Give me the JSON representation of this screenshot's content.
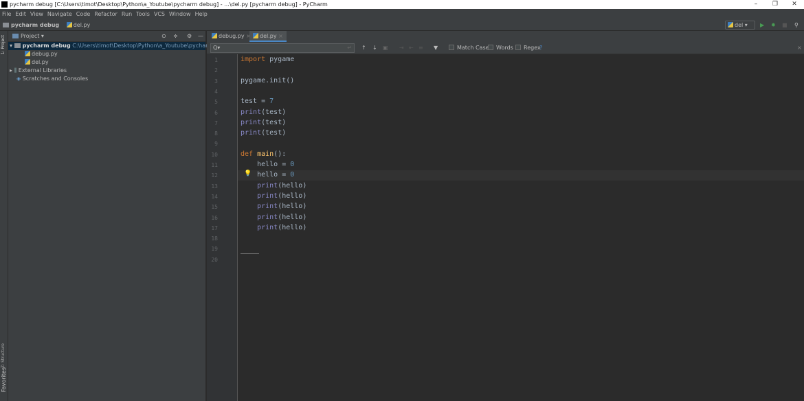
{
  "window": {
    "title": "pycharm debug [C:\\Users\\timot\\Desktop\\Python\\a_Youtube\\pycharm debug] - ...\\del.py [pycharm debug] - PyCharm",
    "minimize": "–",
    "maximize": "❐",
    "close": "✕"
  },
  "menu": [
    "File",
    "Edit",
    "View",
    "Navigate",
    "Code",
    "Refactor",
    "Run",
    "Tools",
    "VCS",
    "Window",
    "Help"
  ],
  "nav": {
    "project": "pycharm debug",
    "file": "del.py",
    "run_config": "del"
  },
  "left_strip": {
    "project": "1: Project",
    "structure": "Z: Structure",
    "favorites": "Favorites"
  },
  "project_panel": {
    "title": "Project",
    "root": "pycharm debug",
    "root_path": "C:\\Users\\timot\\Desktop\\Python\\a_Youtube\\pycharm debug",
    "files": [
      "debug.py",
      "del.py"
    ],
    "external": "External Libraries",
    "scratches": "Scratches and Consoles"
  },
  "tabs": [
    {
      "label": "debug.py",
      "active": false
    },
    {
      "label": "del.py",
      "active": true
    }
  ],
  "find": {
    "query": "",
    "match_case": "Match Case",
    "words": "Words",
    "regex": "Regex",
    "help": "?"
  },
  "code_lines": [
    "import pygame",
    "",
    "pygame.init()",
    "",
    "test = 7",
    "print(test)",
    "print(test)",
    "print(test)",
    "",
    "def main():",
    "    hello = 0",
    "    hello = 0",
    "    print(hello)",
    "    print(hello)",
    "    print(hello)",
    "    print(hello)",
    "    print(hello)",
    "",
    "",
    ""
  ],
  "colors": {
    "keyword": "#cc7832",
    "number": "#6897bb",
    "function": "#ffc66d",
    "builtin": "#8888c6",
    "text": "#a9b7c6",
    "background": "#2b2b2b"
  }
}
